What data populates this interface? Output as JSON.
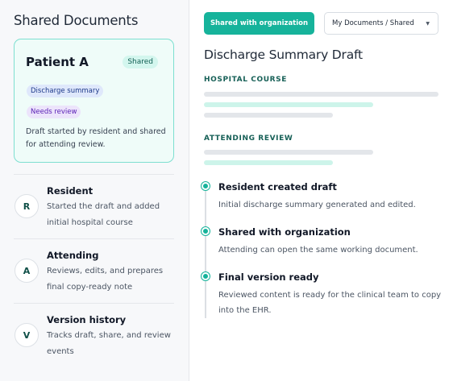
{
  "sidebar": {
    "title": "Shared Documents",
    "patient_card": {
      "name": "Patient A",
      "badge": "Shared",
      "tags": [
        "Discharge summary",
        "Needs review"
      ],
      "description": "Draft started by resident and shared for attending review."
    },
    "roles": [
      {
        "initial": "R",
        "title": "Resident",
        "description": "Started the draft and added initial hospital course"
      },
      {
        "initial": "A",
        "title": "Attending",
        "description": "Reviews, edits, and prepares final copy-ready note"
      },
      {
        "initial": "V",
        "title": "Version history",
        "description": "Tracks draft, share, and review events"
      }
    ]
  },
  "toolbar": {
    "shared_button": "Shared with organization",
    "documents_select": "My Documents / Shared"
  },
  "document": {
    "title": "Discharge Summary Draft",
    "sections": [
      {
        "heading": "HOSPITAL COURSE"
      },
      {
        "heading": "ATTENDING REVIEW"
      }
    ]
  },
  "timeline": [
    {
      "title": "Resident created draft",
      "description": "Initial discharge summary generated and edited."
    },
    {
      "title": "Shared with organization",
      "description": "Attending can open the same working document."
    },
    {
      "title": "Final version ready",
      "description": "Reviewed content is ready for the clinical team to copy into the EHR."
    }
  ],
  "colors": {
    "accent": "#16b39b",
    "card_border": "#7ddfd0",
    "card_background": "#effcf9",
    "section_heading": "#176057",
    "skeleton_gray": "#e3e6ea",
    "skeleton_teal": "#cdf4ea"
  },
  "icons": {
    "select_caret": "chevron-down-icon",
    "timeline_marker": "timeline-dot-icon"
  }
}
